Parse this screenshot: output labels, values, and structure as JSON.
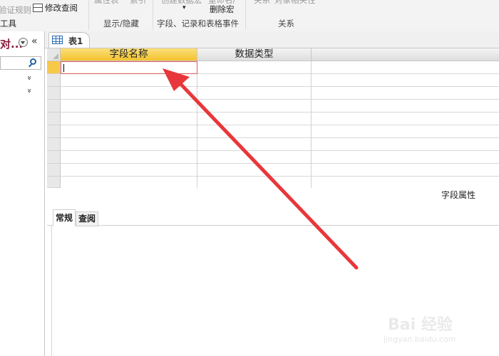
{
  "ribbon": {
    "tool_faded": "验证规则",
    "tool_label": "工具",
    "modify_lookup": "修改查阅",
    "cut_text_a": "属性表",
    "cut_text_b": "索引",
    "create_macro": "创建数据宏",
    "rename_macro": "重命名/",
    "delete_macro": "删除宏",
    "relationships": "关系",
    "object_deps": "对象相关性",
    "groups": {
      "show_hide": "显示/隐藏",
      "events": "字段、记录和表格事件",
      "relations": "关系"
    }
  },
  "nav": {
    "title": "对...",
    "collapse": "«",
    "expand_a": "»",
    "expand_b": "»"
  },
  "doc": {
    "tab_label": "表1"
  },
  "grid": {
    "columns": [
      "字段名称",
      "数据类型"
    ],
    "rows": 10,
    "active_row": 0
  },
  "properties": {
    "label": "字段属性",
    "tabs": [
      "常规",
      "查阅"
    ]
  },
  "watermark": {
    "brand": "Bai 经验",
    "url": "jingyan.baidu.com"
  },
  "colors": {
    "selected_header": "#f3c22e",
    "arrow": "#e8373a",
    "nav_title": "#8b1a3a"
  }
}
